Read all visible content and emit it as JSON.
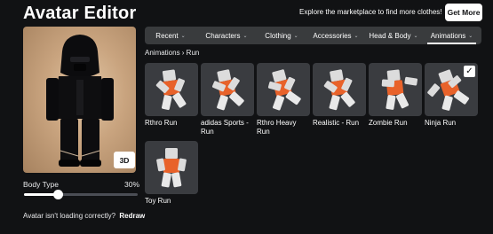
{
  "header": {
    "title": "Avatar Editor",
    "promo_text": "Explore the marketplace to find more clothes!",
    "get_more_label": "Get More"
  },
  "preview": {
    "btn_3d_label": "3D",
    "body_type_label": "Body Type",
    "body_type_value": "30%",
    "body_type_fraction": 0.3,
    "loading_text": "Avatar isn't loading correctly?",
    "redraw_label": "Redraw"
  },
  "tabs": [
    {
      "label": "Recent",
      "icon": "chevron-down-icon"
    },
    {
      "label": "Characters",
      "icon": "chevron-down-icon"
    },
    {
      "label": "Clothing",
      "icon": "chevron-down-icon"
    },
    {
      "label": "Accessories",
      "icon": "chevron-down-icon"
    },
    {
      "label": "Head & Body",
      "icon": "chevron-down-icon"
    },
    {
      "label": "Animations",
      "icon": "chevron-down-icon",
      "active": true
    }
  ],
  "breadcrumb": "Animations › Run",
  "items": [
    {
      "name": "Rthro Run",
      "selected": false
    },
    {
      "name": "adidas Sports - Run",
      "selected": false
    },
    {
      "name": "Rthro Heavy Run",
      "selected": false
    },
    {
      "name": "Realistic - Run",
      "selected": false
    },
    {
      "name": "Zombie Run",
      "selected": false
    },
    {
      "name": "Ninja Run",
      "selected": true
    },
    {
      "name": "Toy Run",
      "selected": false
    }
  ],
  "colors": {
    "background": "#111214",
    "tab_bar": "#393b3d",
    "card": "#3a3c40",
    "avatar_shirt": "#e8622a",
    "avatar_pants": "#e9e9e9"
  }
}
